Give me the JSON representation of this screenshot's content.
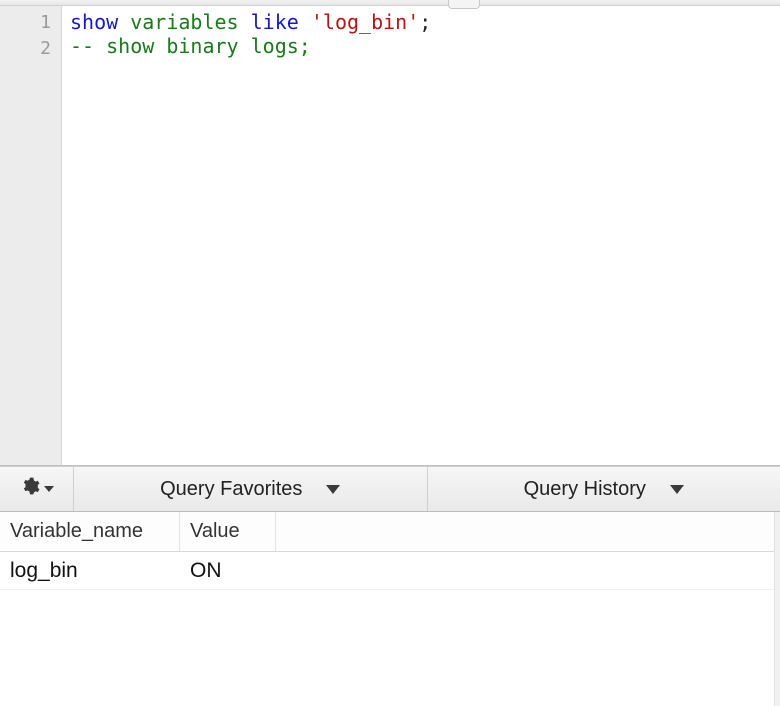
{
  "editor": {
    "lines": [
      {
        "num": "1",
        "tokens": [
          {
            "t": "show",
            "c": "tok-kw"
          },
          {
            "t": " ",
            "c": ""
          },
          {
            "t": "variables",
            "c": "tok-id"
          },
          {
            "t": " ",
            "c": ""
          },
          {
            "t": "like",
            "c": "tok-kw"
          },
          {
            "t": " ",
            "c": ""
          },
          {
            "t": "'log_bin'",
            "c": "tok-str"
          },
          {
            "t": ";",
            "c": "tok-punct"
          }
        ]
      },
      {
        "num": "2",
        "tokens": [
          {
            "t": "-- show binary logs;",
            "c": "tok-comment"
          }
        ]
      }
    ]
  },
  "midbar": {
    "gear_icon": "gear",
    "favorites_label": "Query Favorites",
    "history_label": "Query History"
  },
  "results": {
    "columns": [
      "Variable_name",
      "Value"
    ],
    "rows": [
      {
        "Variable_name": "log_bin",
        "Value": "ON"
      }
    ]
  }
}
